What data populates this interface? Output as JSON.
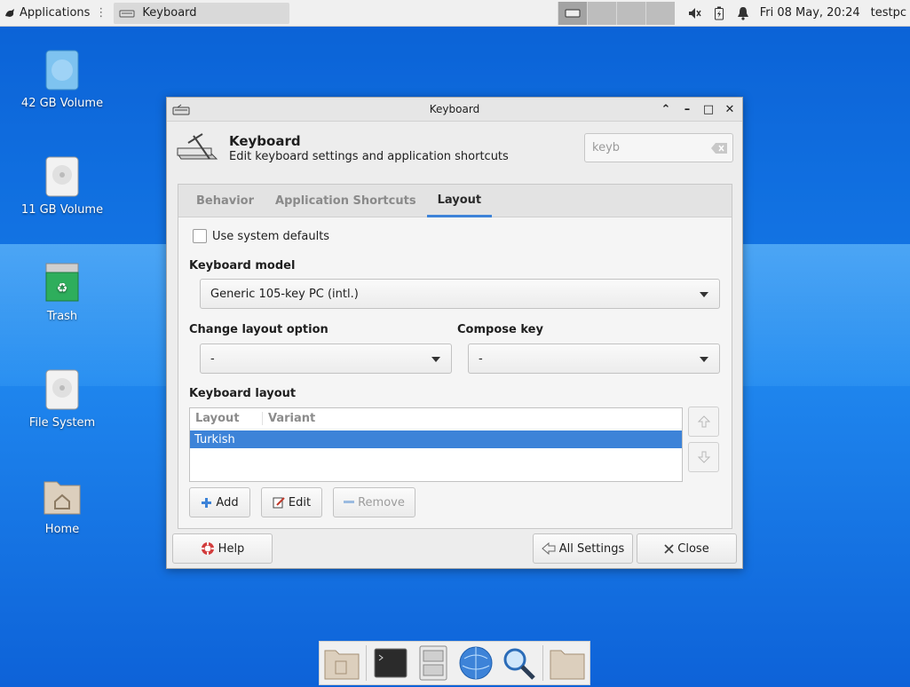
{
  "top_panel": {
    "applications_label": "Applications",
    "task_title": "Keyboard",
    "clock": "Fri 08 May, 20:24",
    "user": "testpc"
  },
  "desktop": {
    "icons": [
      {
        "label": "42 GB Volume",
        "icon": "drive-icon"
      },
      {
        "label": "11 GB Volume",
        "icon": "drive-icon"
      },
      {
        "label": "Trash",
        "icon": "trash-icon"
      },
      {
        "label": "File System",
        "icon": "drive-icon"
      },
      {
        "label": "Home",
        "icon": "home-folder-icon"
      }
    ]
  },
  "window": {
    "title": "Keyboard",
    "header_title": "Keyboard",
    "header_subtitle": "Edit keyboard settings and application shortcuts",
    "search_value": "keyb",
    "tabs": [
      {
        "label": "Behavior",
        "active": false
      },
      {
        "label": "Application Shortcuts",
        "active": false
      },
      {
        "label": "Layout",
        "active": true
      }
    ],
    "layout": {
      "use_system_defaults_label": "Use system defaults",
      "use_system_defaults_checked": false,
      "keyboard_model_label": "Keyboard model",
      "keyboard_model_value": "Generic 105-key PC (intl.)",
      "change_layout_label": "Change layout option",
      "change_layout_value": "-",
      "compose_key_label": "Compose key",
      "compose_key_value": "-",
      "keyboard_layout_label": "Keyboard layout",
      "columns": [
        "Layout",
        "Variant"
      ],
      "rows": [
        {
          "layout": "Turkish",
          "variant": "",
          "selected": true
        }
      ],
      "add_label": "Add",
      "edit_label": "Edit",
      "remove_label": "Remove"
    },
    "footer": {
      "help_label": "Help",
      "all_settings_label": "All Settings",
      "close_label": "Close"
    }
  },
  "colors": {
    "accent": "#3d83d8",
    "desktop": "#1378e6"
  }
}
